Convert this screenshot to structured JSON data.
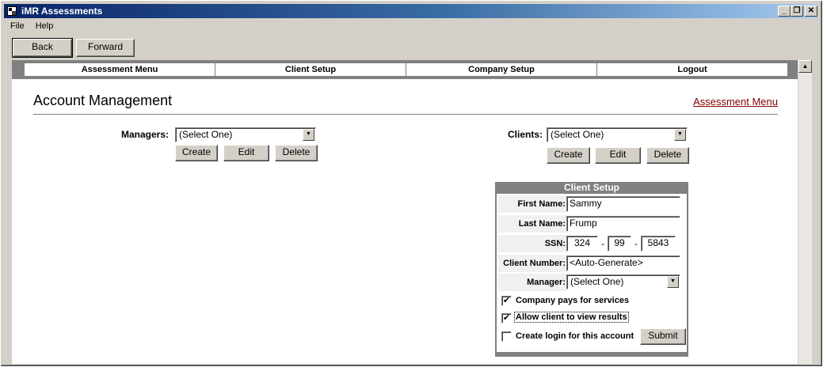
{
  "window": {
    "title": "iMR Assessments",
    "minimize": "_",
    "restore": "❐",
    "close": "✕"
  },
  "menu": [
    "File",
    "Help"
  ],
  "nav_buttons": {
    "back": "Back",
    "forward": "Forward"
  },
  "topnav": [
    "Assessment Menu",
    "Client Setup",
    "Company Setup",
    "Logout"
  ],
  "page": {
    "title": "Account Management",
    "link": "Assessment Menu"
  },
  "managers": {
    "label": "Managers:",
    "selected": "(Select One)",
    "buttons": [
      "Create",
      "Edit",
      "Delete"
    ]
  },
  "clients": {
    "label": "Clients:",
    "selected": "(Select One)",
    "buttons": [
      "Create",
      "Edit",
      "Delete"
    ]
  },
  "client_setup": {
    "title": "Client Setup",
    "first_name_label": "First Name:",
    "first_name": "Sammy",
    "last_name_label": "Last Name:",
    "last_name": "Frump",
    "ssn_label": "SSN:",
    "ssn": [
      "324",
      "99",
      "5843"
    ],
    "ssn_sep": "-",
    "client_number_label": "Client Number:",
    "client_number": "<Auto-Generate>",
    "manager_label": "Manager:",
    "manager_selected": "(Select One)",
    "checkboxes": [
      {
        "label": "Company pays for services",
        "checked": true
      },
      {
        "label": "Allow client to view results",
        "checked": true
      },
      {
        "label": "Create login for this account",
        "checked": false
      }
    ],
    "submit": "Submit"
  }
}
